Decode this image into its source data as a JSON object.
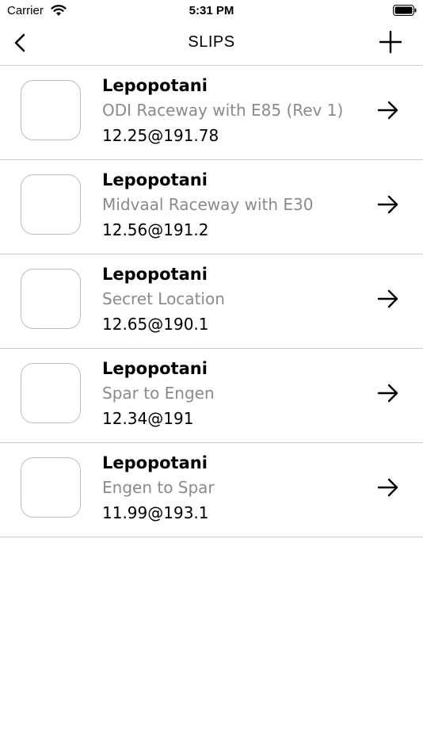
{
  "status_bar": {
    "carrier": "Carrier",
    "time": "5:31 PM"
  },
  "nav": {
    "title": "SLIPS"
  },
  "slips": [
    {
      "name": "Lepopotani",
      "track": "ODI Raceway with E85 (Rev 1)",
      "result": "12.25@191.78"
    },
    {
      "name": "Lepopotani",
      "track": "Midvaal Raceway with E30",
      "result": "12.56@191.2"
    },
    {
      "name": "Lepopotani",
      "track": "Secret Location",
      "result": "12.65@190.1"
    },
    {
      "name": "Lepopotani",
      "track": "Spar to Engen",
      "result": "12.34@191"
    },
    {
      "name": "Lepopotani",
      "track": "Engen to Spar",
      "result": "11.99@193.1"
    }
  ]
}
